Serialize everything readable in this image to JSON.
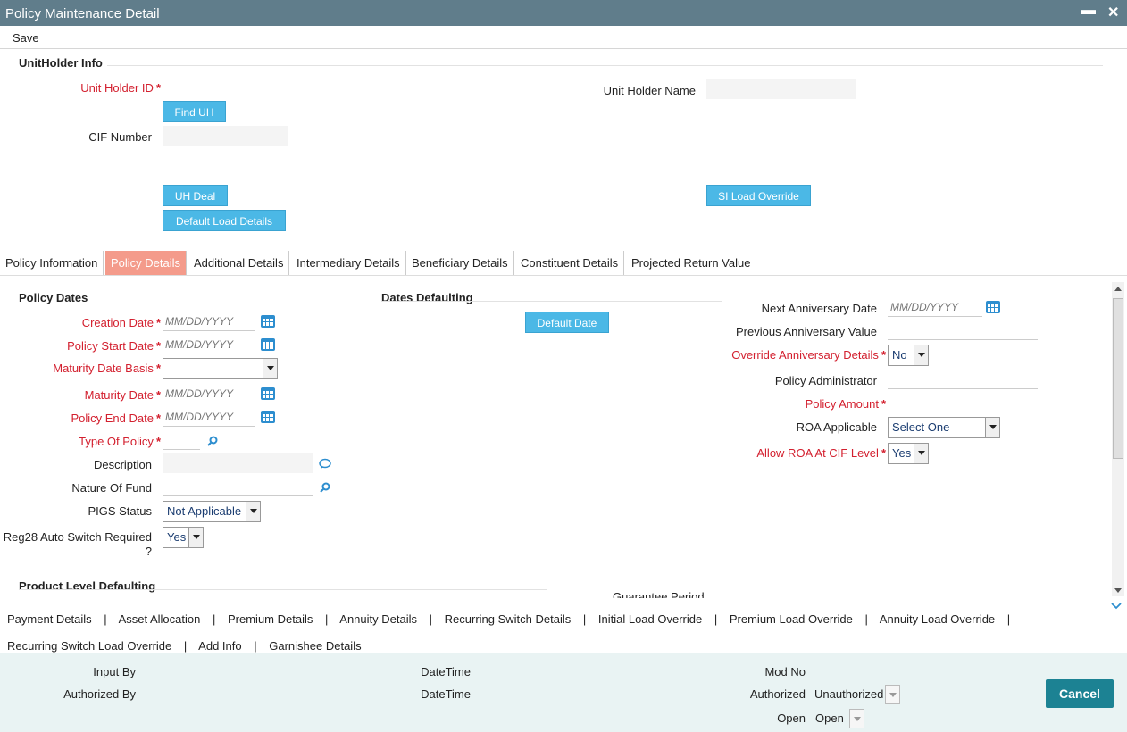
{
  "window": {
    "title": "Policy Maintenance Detail",
    "minimize": "▬",
    "close": "✕"
  },
  "menu": {
    "save": "Save"
  },
  "unitholder": {
    "section_title": "UnitHolder Info",
    "uh_id_label": "Unit Holder ID",
    "uh_id_value": "",
    "find_uh": "Find UH",
    "cif_label": "CIF Number",
    "cif_value": "",
    "uh_name_label": "Unit Holder Name",
    "uh_name_value": "",
    "uh_deal": "UH Deal",
    "default_load": "Default Load Details",
    "si_load_override": "SI Load Override"
  },
  "tabs": [
    {
      "label": "Policy Information"
    },
    {
      "label": "Policy Details"
    },
    {
      "label": "Additional Details"
    },
    {
      "label": "Intermediary Details"
    },
    {
      "label": "Beneficiary Details"
    },
    {
      "label": "Constituent Details"
    },
    {
      "label": "Projected Return Value"
    }
  ],
  "policy_dates": {
    "section_title": "Policy Dates",
    "date_placeholder": "MM/DD/YYYY",
    "creation_date": "Creation Date",
    "policy_start_date": "Policy Start Date",
    "maturity_date_basis": "Maturity Date Basis",
    "maturity_date_basis_value": "",
    "maturity_date": "Maturity Date",
    "policy_end_date": "Policy End Date",
    "type_of_policy": "Type Of Policy",
    "description": "Description",
    "nature_of_fund": "Nature Of Fund",
    "pigs_status": "PIGS Status",
    "pigs_status_value": "Not Applicable",
    "reg28_line1": "Reg28 Auto Switch Required",
    "reg28_line2": "?",
    "reg28_value": "Yes"
  },
  "dates_defaulting": {
    "section_title": "Dates Defaulting",
    "default_date": "Default Date"
  },
  "right_fields": {
    "next_anniversary": "Next Anniversary Date",
    "next_anniversary_placeholder": "MM/DD/YYYY",
    "previous_anniversary": "Previous Anniversary Value",
    "override_anniversary": "Override Anniversary Details",
    "override_anniversary_value": "No",
    "policy_administrator": "Policy Administrator",
    "policy_amount": "Policy Amount",
    "roa_applicable": "ROA Applicable",
    "roa_applicable_value": "Select One",
    "allow_roa": "Allow ROA At CIF Level",
    "allow_roa_value": "Yes"
  },
  "product_level": {
    "section_title": "Product Level Defaulting",
    "guarantee_period": "Guarantee Period"
  },
  "subscreen_links": [
    "Payment Details",
    "Asset Allocation",
    "Premium Details",
    "Annuity Details",
    "Recurring Switch Details",
    "Initial Load Override",
    "Premium Load Override",
    "Annuity Load Override",
    "Recurring Switch Load Override",
    "Add Info",
    "Garnishee Details"
  ],
  "link_separator": "|",
  "audit": {
    "input_by": "Input By",
    "authorized_by": "Authorized By",
    "datetime1": "DateTime",
    "datetime2": "DateTime",
    "mod_no": "Mod No",
    "authorized": "Authorized",
    "authorized_value": "Unauthorized",
    "open": "Open",
    "open_value": "Open",
    "cancel": "Cancel"
  },
  "colors": {
    "titlebar": "#607d8b",
    "button": "#4bb8e6",
    "active_tab": "#f49b8b",
    "required": "#d3202f",
    "cancel": "#1c8293",
    "footer": "#e9f3f3"
  }
}
